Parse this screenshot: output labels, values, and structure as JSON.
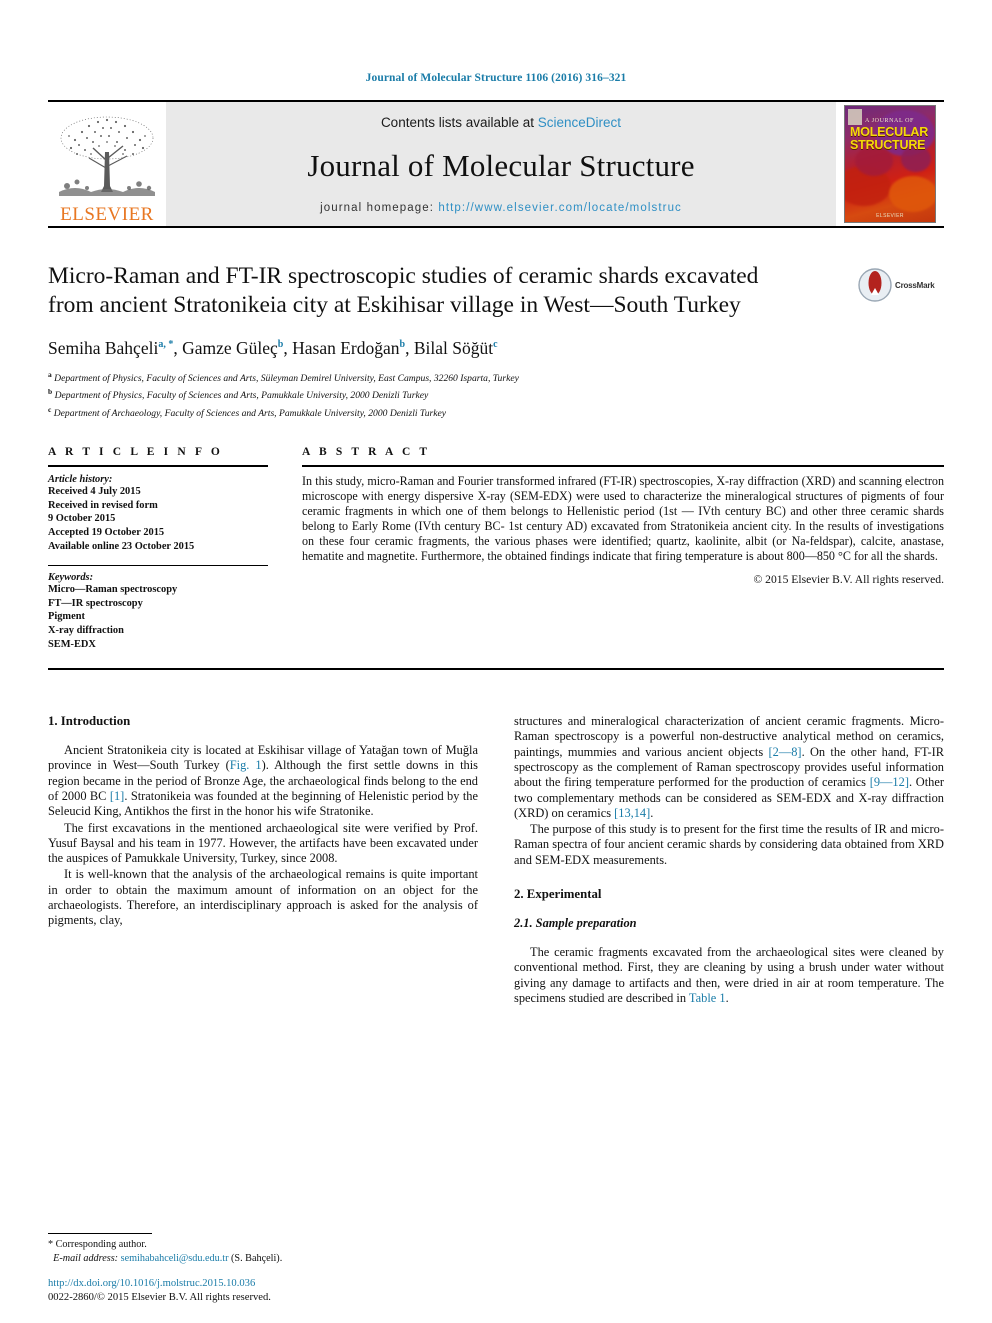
{
  "running_head": "Journal of Molecular Structure 1106 (2016) 316–321",
  "masthead": {
    "publisher_logo_word": "ELSEVIER",
    "contents_prefix": "Contents lists available at ",
    "contents_link": "ScienceDirect",
    "journal_title": "Journal of Molecular Structure",
    "homepage_prefix": "journal homepage: ",
    "homepage_url": "http://www.elsevier.com/locate/molstruc",
    "cover": {
      "small_line": "A JOURNAL OF",
      "title_line1": "MOLECULAR",
      "title_line2": "STRUCTURE",
      "footer": "ELSEVIER"
    }
  },
  "article": {
    "title": "Micro-Raman and FT-IR spectroscopic studies of ceramic shards excavated from ancient Stratonikeia city at Eskihisar village in West—South Turkey",
    "crossmark_label": "CrossMark",
    "authors": [
      {
        "name": "Semiha Bahçeli",
        "marks": "a, *"
      },
      {
        "name": "Gamze Güleç",
        "marks": "b"
      },
      {
        "name": "Hasan Erdoğan",
        "marks": "b"
      },
      {
        "name": "Bilal Söğüt",
        "marks": "c"
      }
    ],
    "affiliations": [
      {
        "mark": "a",
        "text": "Department of Physics, Faculty of Sciences and Arts, Süleyman Demirel University, East Campus, 32260 Isparta, Turkey"
      },
      {
        "mark": "b",
        "text": "Department of Physics, Faculty of Sciences and Arts, Pamukkale University, 2000 Denizli Turkey"
      },
      {
        "mark": "c",
        "text": "Department of Archaeology, Faculty of Sciences and Arts, Pamukkale University, 2000 Denizli Turkey"
      }
    ]
  },
  "article_info": {
    "heading": "A R T I C L E   I N F O",
    "history_label": "Article history:",
    "history": [
      "Received 4 July 2015",
      "Received in revised form",
      "9 October 2015",
      "Accepted 19 October 2015",
      "Available online 23 October 2015"
    ],
    "keywords_label": "Keywords:",
    "keywords": [
      "Micro—Raman spectroscopy",
      "FT—IR spectroscopy",
      "Pigment",
      "X-ray diffraction",
      "SEM-EDX"
    ]
  },
  "abstract": {
    "heading": "A B S T R A C T",
    "text": "In this study, micro-Raman and Fourier transformed infrared (FT-IR) spectroscopies, X-ray diffraction (XRD) and scanning electron microscope with energy dispersive X-ray (SEM-EDX) were used to characterize the mineralogical structures of pigments of four ceramic fragments in which one of them belongs to Hellenistic period (1st — IVth century BC) and other three ceramic shards belong to Early Rome (IVth century BC- 1st century AD) excavated from Stratonikeia ancient city. In the results of investigations on these four ceramic fragments, the various phases were identified; quartz, kaolinite, albit (or Na-feldspar), calcite, anastase, hematite and magnetite. Furthermore, the obtained findings indicate that firing temperature is about 800—850 °C for all the shards.",
    "copyright": "© 2015 Elsevier B.V. All rights reserved."
  },
  "body": {
    "sec1_heading": "1.  Introduction",
    "p1_a": "Ancient Stratonikeia city is located at Eskihisar village of Yatağan town of Muğla province in West—South Turkey (",
    "p1_fig": "Fig. 1",
    "p1_b": "). Although the first settle downs in this region became in the period of Bronze Age, the archaeological finds belong to the end of 2000 BC ",
    "p1_ref": "[1]",
    "p1_c": ". Stratonikeia was founded at the beginning of Helenistic period by the Seleucid King, Antikhos the first in the honor his wife Stratonike.",
    "p2": "The first excavations in the mentioned archaeological site were verified by Prof. Yusuf Baysal and his team in 1977. However, the artifacts have been excavated under the auspices of Pamukkale University, Turkey, since 2008.",
    "p3": "It is well-known that the analysis of the archaeological remains is quite important in order to obtain the maximum amount of information on an object for the archaeologists. Therefore, an interdisciplinary approach is asked for the analysis of pigments, clay,",
    "p4_a": "structures and mineralogical characterization of ancient ceramic fragments. Micro-Raman spectroscopy is a powerful non-destructive analytical method on ceramics, paintings, mummies and various ancient objects ",
    "p4_ref1": "[2—8]",
    "p4_b": ". On the other hand, FT-IR spectroscopy as the complement of Raman spectroscopy provides useful information about the firing temperature performed for the production of ceramics ",
    "p4_ref2": "[9—12]",
    "p4_c": ". Other two complementary methods can be considered as SEM-EDX and X-ray diffraction (XRD) on ceramics ",
    "p4_ref3": "[13,14]",
    "p4_d": ".",
    "p5": "The purpose of this study is to present for the first time the results of IR and micro-Raman spectra of four ancient ceramic shards by considering data obtained from XRD and SEM-EDX measurements.",
    "sec2_heading": "2.  Experimental",
    "sec21_heading": "2.1.  Sample preparation",
    "p6_a": "The ceramic fragments excavated from the archaeological sites were cleaned by conventional method. First, they are cleaning by using a brush under water without giving any damage to artifacts and then, were dried in air at room temperature. The specimens studied are described in ",
    "p6_link": "Table 1",
    "p6_b": "."
  },
  "footnote": {
    "corresponding": "* Corresponding author.",
    "email_label": "E-mail address:",
    "email": "semihabahceli@sdu.edu.tr",
    "email_suffix": " (S. Bahçeli).",
    "doi": "http://dx.doi.org/10.1016/j.molstruc.2015.10.036",
    "issn": "0022-2860/© 2015 Elsevier B.V. All rights reserved."
  },
  "colors": {
    "link": "#1a7ca8",
    "sciencedirect": "#2f8fc4",
    "elsevier_orange": "#e87722"
  }
}
